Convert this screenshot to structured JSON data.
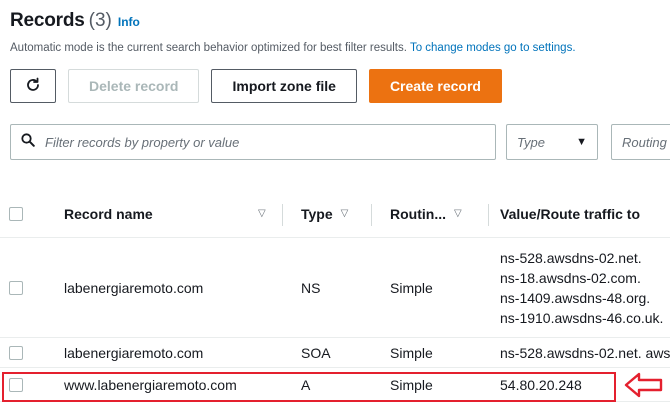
{
  "header": {
    "title": "Records",
    "count": "(3)",
    "info_link": "Info",
    "description": "Automatic mode is the current search behavior optimized for best filter results.",
    "description_link": "To change modes go to settings."
  },
  "toolbar": {
    "refresh_icon": "refresh-icon",
    "delete_label": "Delete record",
    "import_label": "Import zone file",
    "create_label": "Create record"
  },
  "filters": {
    "search_placeholder": "Filter records by property or value",
    "type_placeholder": "Type",
    "routing_placeholder": "Routing"
  },
  "table": {
    "columns": {
      "name": "Record name",
      "type": "Type",
      "routing": "Routin...",
      "value": "Value/Route traffic to"
    },
    "rows": [
      {
        "name": "labenergiaremoto.com",
        "type": "NS",
        "routing": "Simple",
        "values": [
          "ns-528.awsdns-02.net.",
          "ns-18.awsdns-02.com.",
          "ns-1409.awsdns-48.org.",
          "ns-1910.awsdns-46.co.uk."
        ]
      },
      {
        "name": "labenergiaremoto.com",
        "type": "SOA",
        "routing": "Simple",
        "values": [
          "ns-528.awsdns-02.net. aws"
        ]
      },
      {
        "name": "www.labenergiaremoto.com",
        "type": "A",
        "routing": "Simple",
        "values": [
          "54.80.20.248"
        ]
      }
    ]
  },
  "annotation": {
    "highlight_color": "#e4202e"
  },
  "colors": {
    "accent": "#ec7211",
    "link": "#0073bb"
  }
}
